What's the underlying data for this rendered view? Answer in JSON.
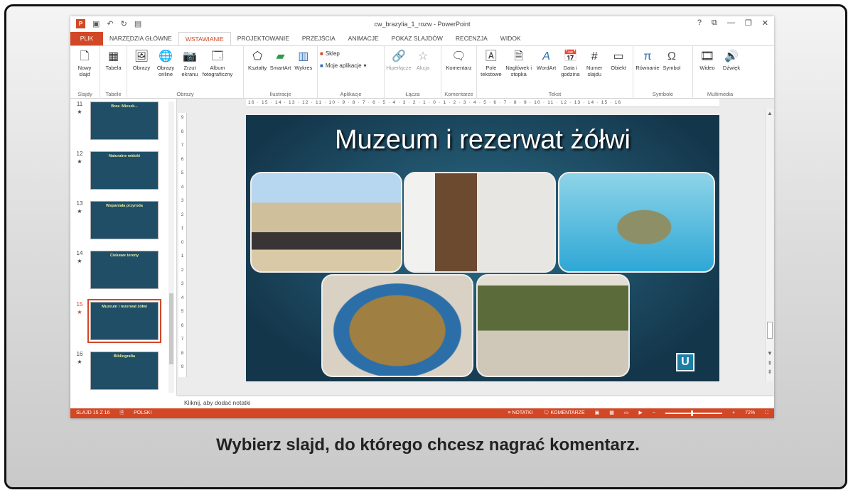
{
  "window": {
    "title": "cw_brazylia_1_rozw - PowerPoint",
    "controls": [
      "?",
      "⧉",
      "—",
      "❐",
      "✕"
    ]
  },
  "qat": {
    "undo": "↶",
    "redo": "↻"
  },
  "tabs": [
    {
      "label": "PLIK"
    },
    {
      "label": "NARZĘDZIA GŁÓWNE"
    },
    {
      "label": "WSTAWIANIE"
    },
    {
      "label": "PROJEKTOWANIE"
    },
    {
      "label": "PRZEJŚCIA"
    },
    {
      "label": "ANIMACJE"
    },
    {
      "label": "POKAZ SLAJDÓW"
    },
    {
      "label": "RECENZJA"
    },
    {
      "label": "WIDOK"
    }
  ],
  "ribbon": {
    "slajdy": {
      "name": "Slajdy",
      "new_slide": "Nowy slajd"
    },
    "tabele": {
      "name": "Tabele",
      "table": "Tabela"
    },
    "obrazy": {
      "name": "Obrazy",
      "pictures": "Obrazy",
      "online": "Obrazy online",
      "screenshot": "Zrzut ekranu",
      "album": "Album fotograficzny"
    },
    "ilustracje": {
      "name": "Ilustracje",
      "shapes": "Kształty",
      "smartart": "SmartArt",
      "chart": "Wykres"
    },
    "aplikacje": {
      "name": "Aplikacje",
      "store": "Sklep",
      "apps": "Moje aplikacje"
    },
    "lacza": {
      "name": "Łącza",
      "hyperlink": "Hiperłącze",
      "action": "Akcja"
    },
    "komentarze": {
      "name": "Komentarze",
      "comment": "Komentarz"
    },
    "tekst": {
      "name": "Tekst",
      "textbox": "Pole tekstowe",
      "header": "Nagłówek i stopka",
      "wordart": "WordArt",
      "datetime": "Data i godzina",
      "slidenum": "Numer slajdu",
      "object": "Obiekt"
    },
    "symbole": {
      "name": "Symbole",
      "equation": "Równanie",
      "symbol": "Symbol"
    },
    "multimedia": {
      "name": "Multimedia",
      "video": "Wideo",
      "audio": "Dźwięk"
    }
  },
  "thumbnails": [
    {
      "num": "11",
      "title": "Braz. Mieszk..."
    },
    {
      "num": "12",
      "title": "Naturalne widoki"
    },
    {
      "num": "13",
      "title": "Wspaniała przyroda"
    },
    {
      "num": "14",
      "title": "Ciekawe tereny"
    },
    {
      "num": "15",
      "title": "Muzeum i rezerwat żółwi"
    },
    {
      "num": "16",
      "title": "Bibliografia"
    }
  ],
  "star": "★",
  "ruler": {
    "h": "16 · 15 · 14 · 13 · 12 · 11 · 10 · 9 · 8 · 7 · 6 · 5 · 4 · 3 · 2 · 1 · 0 · 1 · 2 · 3 · 4 · 5 · 6 · 7 · 8 · 9 · 10 · 11 · 12 · 13 · 14 · 15 · 16"
  },
  "slide": {
    "title": "Muzeum i rezerwat żółwi"
  },
  "notes": "Kliknij, aby dodać notatki",
  "status": {
    "slide": "SLAJD 15 Z 16",
    "lang": "POLSKI",
    "notes": "NOTATKI",
    "comments": "KOMENTARZE",
    "zoom": "72%"
  },
  "caption": "Wybierz slajd, do którego chcesz nagrać komentarz."
}
